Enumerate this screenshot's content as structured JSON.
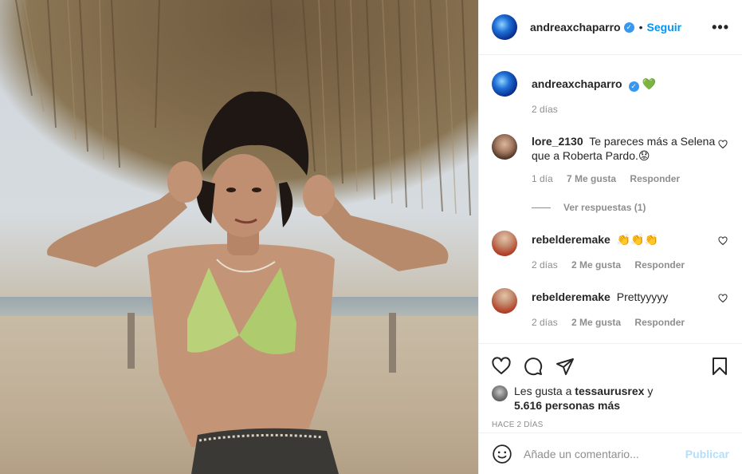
{
  "header": {
    "username": "andreaxchaparro",
    "separator": "•",
    "follow_label": "Seguir",
    "more_label": "•••"
  },
  "caption": {
    "username": "andreaxchaparro",
    "text": "💚",
    "time": "2 días"
  },
  "comments": [
    {
      "username": "lore_2130",
      "text": "Te pareces más a Selena que a Roberta Pardo.😟",
      "time": "1 día",
      "likes": "7 Me gusta",
      "reply_label": "Responder",
      "view_replies": "Ver respuestas (1)"
    },
    {
      "username": "rebelderemake",
      "text": "👏👏👏",
      "time": "2 días",
      "likes": "2 Me gusta",
      "reply_label": "Responder"
    },
    {
      "username": "rebelderemake",
      "text": "Prettyyyyy",
      "time": "2 días",
      "likes": "2 Me gusta",
      "reply_label": "Responder"
    }
  ],
  "likes": {
    "prefix": "Les gusta a",
    "user": "tessaurusrex",
    "conj": "y",
    "count_text": "5.616 personas más"
  },
  "posted": "Hace 2 días",
  "composer": {
    "placeholder": "Añade un comentario...",
    "publish_label": "Publicar"
  },
  "colors": {
    "accent": "#0095f6",
    "verified": "#3897f0",
    "muted": "#8e8e8e",
    "publish_disabled": "#b2dffc"
  }
}
